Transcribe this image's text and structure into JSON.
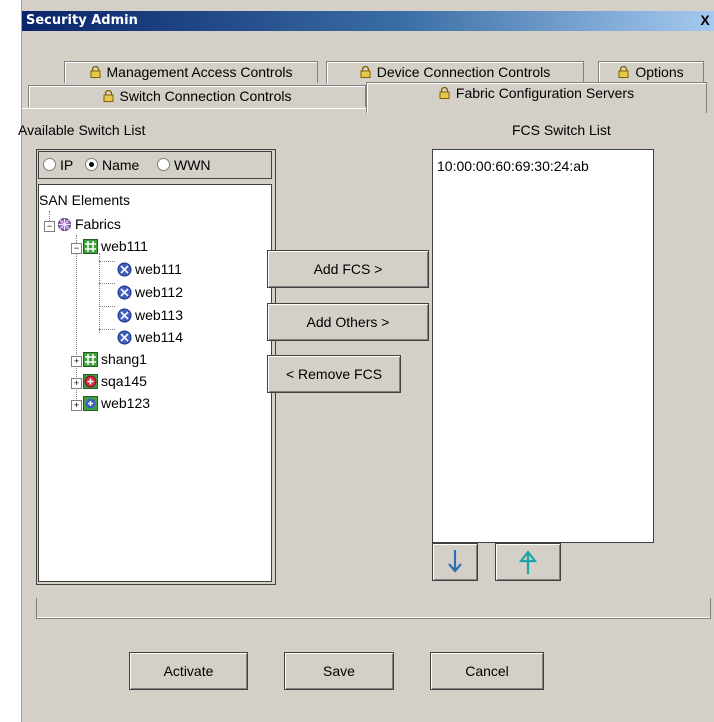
{
  "window": {
    "title": "Security Admin",
    "close_label": "X"
  },
  "tabs": {
    "row1": [
      {
        "label": "Management Access Controls"
      },
      {
        "label": "Device Connection Controls"
      },
      {
        "label": "Options"
      }
    ],
    "row2": [
      {
        "label": "Switch Connection Controls"
      },
      {
        "label": "Fabric Configuration Servers",
        "active": true
      }
    ]
  },
  "left": {
    "heading": "Available Switch List",
    "radio_options": [
      {
        "label": "IP",
        "selected": false
      },
      {
        "label": "Name",
        "selected": true
      },
      {
        "label": "WWN",
        "selected": false
      }
    ],
    "tree": {
      "root": "SAN Elements",
      "fabrics": "Fabrics",
      "web111_fabric": "web111",
      "switches": [
        "web111",
        "web112",
        "web113",
        "web114"
      ],
      "others": [
        "shang1",
        "sqa145",
        "web123"
      ]
    }
  },
  "middle": {
    "add_fcs": "Add FCS >",
    "add_others": "Add Others >",
    "remove_fcs": "< Remove FCS"
  },
  "right": {
    "heading": "FCS Switch List",
    "items": [
      "10:00:00:60:69:30:24:ab"
    ]
  },
  "footer": {
    "activate": "Activate",
    "save": "Save",
    "cancel": "Cancel"
  },
  "colors": {
    "title_gradient_start": "#0a246a",
    "title_gradient_end": "#a6caf0",
    "dialog_bg": "#d4d0c8",
    "arrow_down": "#2d6fb3",
    "arrow_up": "#1aa4a4"
  },
  "icons": {
    "tab": "lock-icon",
    "fabrics": "fabric-globe-icon",
    "fabric_switch": "switch-group-icon",
    "switch": "switch-node-icon",
    "sqa145": "red-fabric-icon",
    "move_down": "arrow-down-icon",
    "move_up": "arrow-up-icon"
  }
}
